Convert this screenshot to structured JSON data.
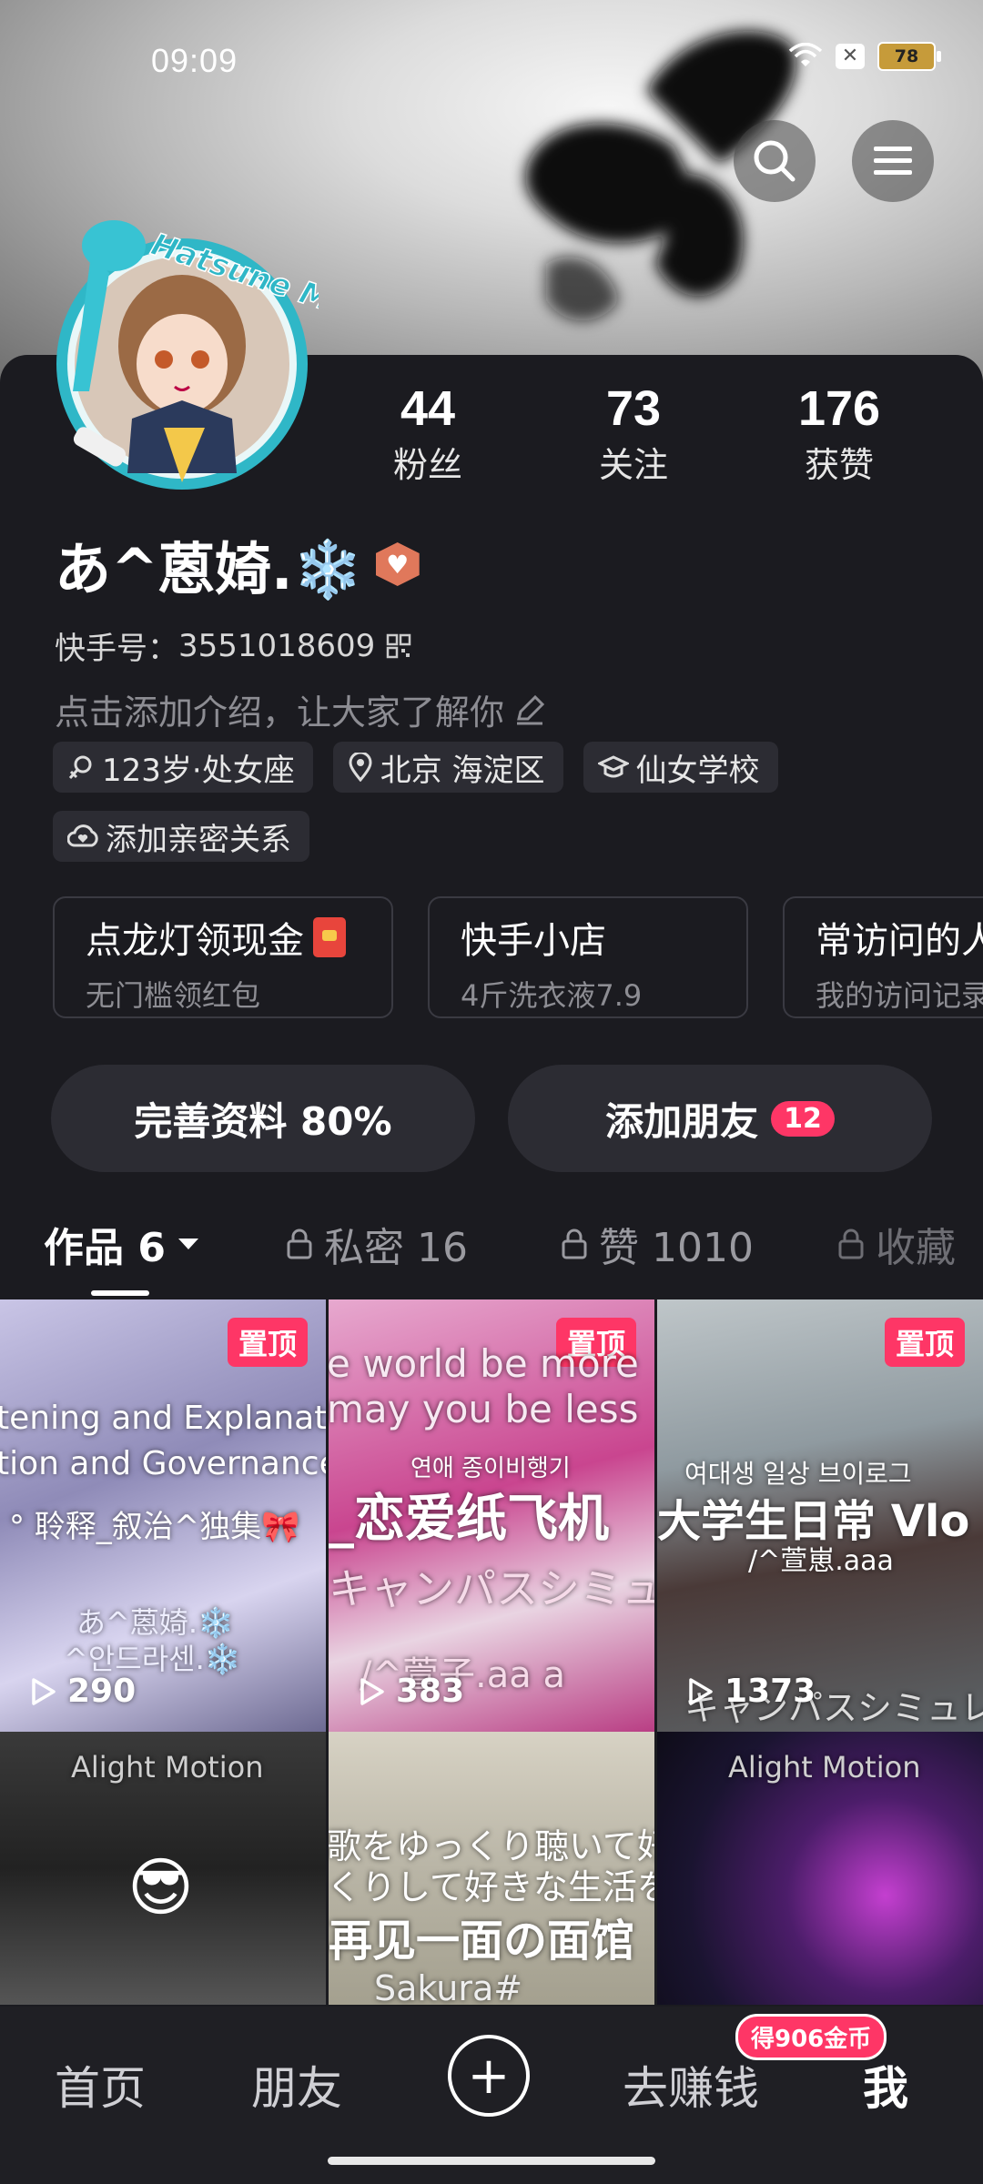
{
  "status": {
    "time": "09:09",
    "battery": "78"
  },
  "profile": {
    "avatar_text": "Hatsune Miku",
    "name": "あ^蒽婍.❄️",
    "kuaishou_id_label": "快手号：",
    "kuaishou_id": "3551018609",
    "intro_placeholder": "点击添加介绍，让大家了解你"
  },
  "stats": [
    {
      "num": "44",
      "label": "粉丝"
    },
    {
      "num": "73",
      "label": "关注"
    },
    {
      "num": "176",
      "label": "获赞"
    }
  ],
  "tags": [
    "123岁·处女座",
    "北京 海淀区",
    "仙女学校",
    "添加亲密关系"
  ],
  "cards": [
    {
      "title": "点龙灯领现金",
      "sub": "无门槛领红包"
    },
    {
      "title": "快手小店",
      "sub": "4斤洗衣液7.9"
    },
    {
      "title": "常访问的人",
      "sub": "我的访问记录"
    }
  ],
  "actions": {
    "complete_profile": "完善资料 80%",
    "add_friends": "添加朋友",
    "add_friends_count": "12"
  },
  "tabs": [
    {
      "label": "作品 6"
    },
    {
      "label": "私密 16"
    },
    {
      "label": "赞 1010"
    },
    {
      "label": "收藏"
    }
  ],
  "videos": [
    {
      "pinned": "置顶",
      "plays": "290",
      "line1": "tening and Explanat",
      "line2": "tion and Governance",
      "line3": "° 聆释_叙治^独集🎀",
      "line4": "あ^蒽婍.❄️",
      "line5": "^안드라센.❄️"
    },
    {
      "pinned": "置顶",
      "plays": "383",
      "line1": "e world be more",
      "line2": "may you be less",
      "line3": "연애 종이비행기",
      "line4": "_恋爱纸飞机",
      "line5": "キャンパスシミュ",
      "line6": "/^萱子.aa a"
    },
    {
      "pinned": "置顶",
      "plays": "1373",
      "line1": "여대생 일상 브이로그",
      "line2": "大学生日常 Vlo",
      "line3": "/^萱崽.aaa",
      "line4": "キャンパスシミュレ"
    },
    {
      "line1": "Alight Motion"
    },
    {
      "line1": "歌をゆっくり聴いて好",
      "line2": "くりして好きな生活を",
      "line3": "再见一面の面馆",
      "line4": "Sakura#"
    },
    {
      "line1": "Alight Motion"
    }
  ],
  "nav": {
    "home": "首页",
    "friends": "朋友",
    "earn": "去赚钱",
    "earn_badge": "得906金币",
    "me": "我"
  },
  "colors": {
    "accent": "#fe3666",
    "background": "#1b1b20"
  }
}
